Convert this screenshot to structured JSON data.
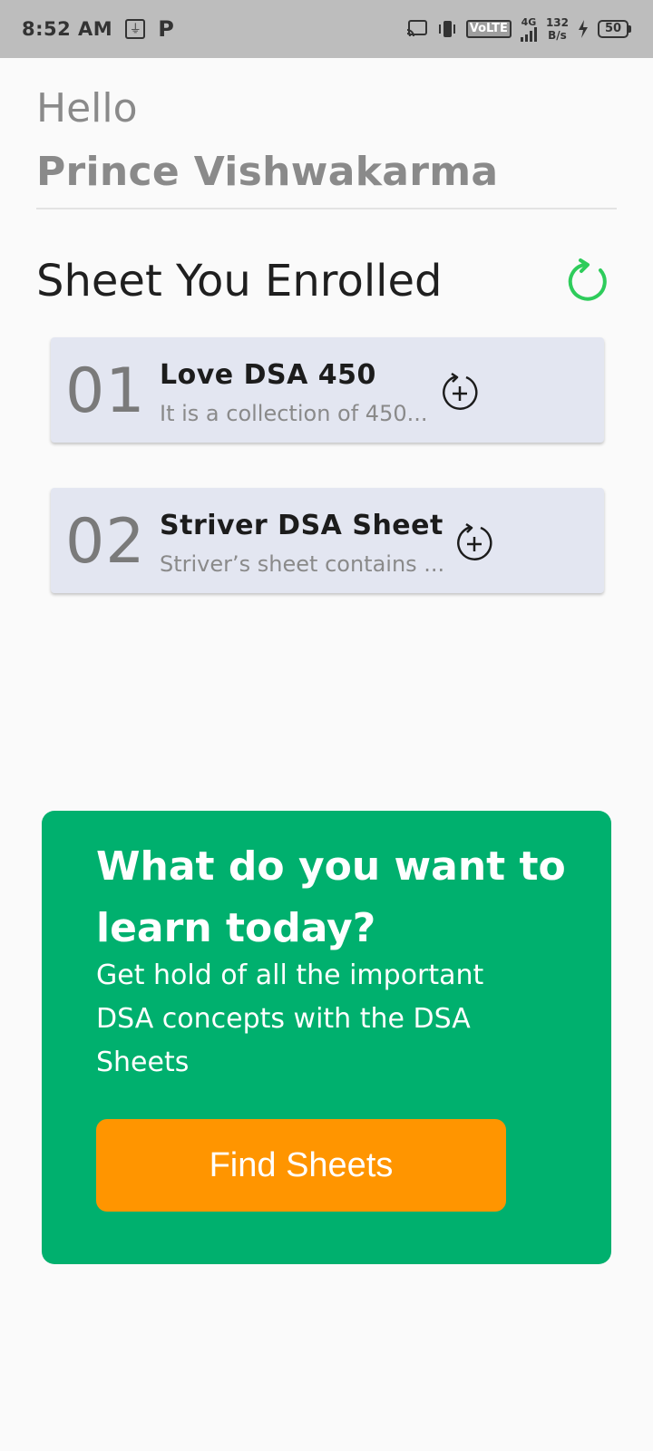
{
  "status_bar": {
    "time": "8:52 AM",
    "usb_icon": "usb-debug-icon",
    "p_icon": "P",
    "volte": "VoLTE",
    "network": "4G",
    "speed_value": "132",
    "speed_unit": "B/s",
    "battery": "50"
  },
  "greeting": {
    "hello": "Hello",
    "name": "Prince Vishwakarma"
  },
  "section": {
    "title": "Sheet You Enrolled"
  },
  "sheets": [
    {
      "number": "01",
      "title": "Love DSA 450",
      "description": "It is a collection of 450..."
    },
    {
      "number": "02",
      "title": "Striver DSA Sheet",
      "description": "Striver’s sheet contains ..."
    }
  ],
  "promo": {
    "title": "What do you want to  learn today?",
    "description": "Get hold of all the important DSA concepts with the DSA Sheets",
    "button_label": "Find Sheets"
  },
  "colors": {
    "promo_bg": "#00b06e",
    "button_bg": "#ff9500",
    "card_bg": "#e3e6f1",
    "refresh_green": "#2ecc5b"
  }
}
